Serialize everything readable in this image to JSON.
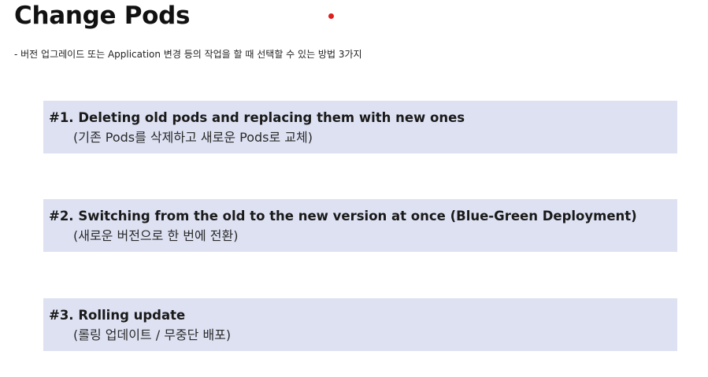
{
  "slide": {
    "title": "Change Pods",
    "subtitle": "- 버전 업그레이드 또는 Application 변경 등의 작업을 할 때 선택할 수 있는 방법 3가지",
    "pointer_color": "#e11d1d",
    "card_background": "#dde1f2",
    "items": [
      {
        "heading": "#1. Deleting old pods and replacing them with new ones",
        "subtext": "(기존 Pods를 삭제하고 새로운 Pods로 교체)"
      },
      {
        "heading": "#2. Switching from the old to the new version at once (Blue-Green Deployment)",
        "subtext": "(새로운 버전으로 한 번에 전환)"
      },
      {
        "heading": "#3. Rolling update",
        "subtext": "(롤링 업데이트 / 무중단 배포)"
      }
    ]
  }
}
